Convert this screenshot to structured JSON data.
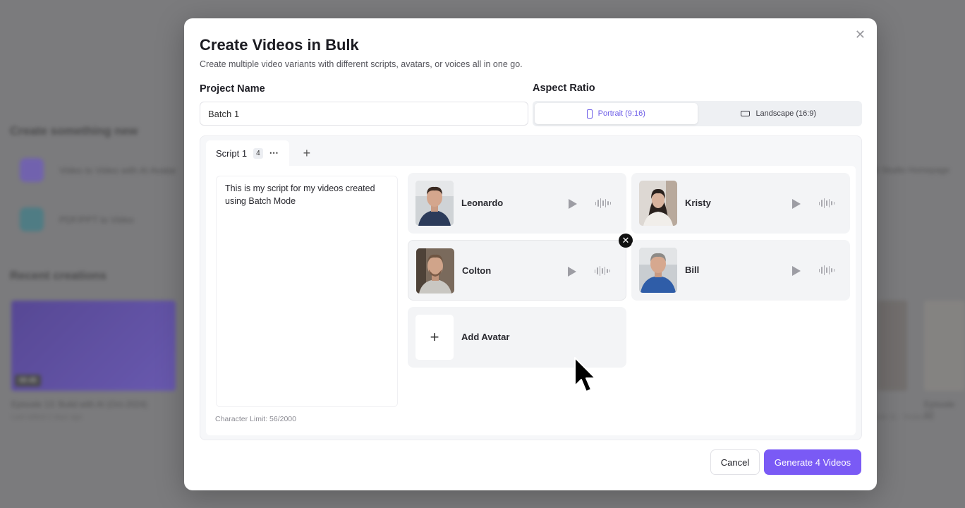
{
  "background": {
    "heading_create": "Create something new",
    "create_items": [
      {
        "label": "Video to Video with AI Avatar"
      },
      {
        "label": "PDF/PPT to Video"
      }
    ],
    "heading_recent": "Recent creations",
    "right_link": "AI Studio Homepage",
    "recent_badge": "00:45",
    "recent_title": "Episode 13: Build with AI (Oct-2024)",
    "recent_date": "Last edited 2 days ago",
    "right_captions": [
      "Episode 12",
      "Episode 11 · Yesterday"
    ]
  },
  "modal": {
    "title": "Create Videos in Bulk",
    "subtitle": "Create multiple video variants with different scripts, avatars, or voices all in one go.",
    "close_icon": "close-icon",
    "project_name_label": "Project Name",
    "project_name_value": "Batch 1",
    "aspect_ratio_label": "Aspect Ratio",
    "ratio_options": [
      {
        "label": "Portrait (9:16)",
        "icon": "phone-icon",
        "selected": true
      },
      {
        "label": "Landscape (16:9)",
        "icon": "landscape-icon",
        "selected": false
      }
    ],
    "tab": {
      "label": "Script 1",
      "count": "4",
      "more": "⋯",
      "add": "+"
    },
    "script_text": "This is my script for my videos created using Batch Mode",
    "char_limit": "Character Limit: 56/2000",
    "avatars": [
      {
        "name": "Leonardo"
      },
      {
        "name": "Kristy"
      },
      {
        "name": "Colton"
      },
      {
        "name": "Bill"
      }
    ],
    "add_avatar_label": "Add Avatar",
    "cancel_label": "Cancel",
    "generate_label": "Generate 4 Videos",
    "accent_color": "#7a5af5"
  }
}
